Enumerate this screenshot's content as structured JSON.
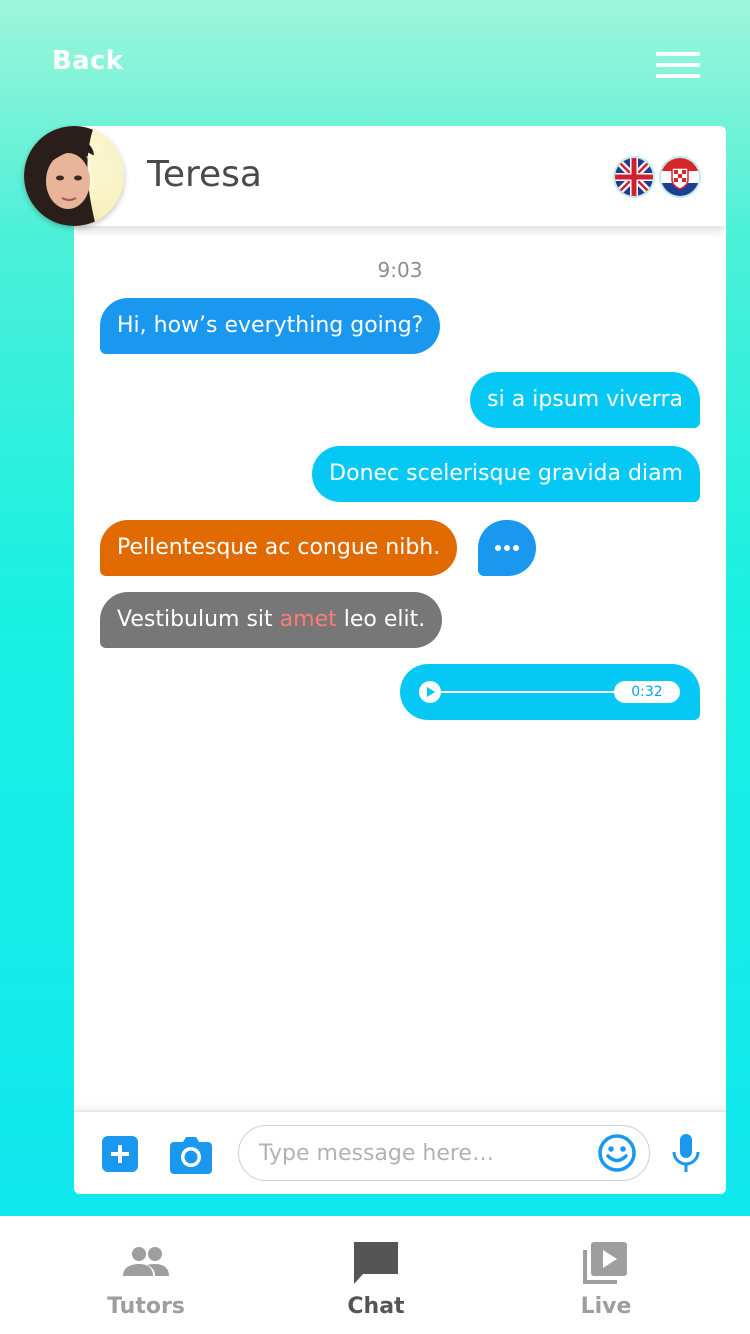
{
  "header": {
    "back_label": "Back",
    "menu_icon": "hamburger-menu-icon"
  },
  "contact": {
    "name": "Teresa",
    "flags": [
      "uk-flag-icon",
      "croatia-flag-icon"
    ]
  },
  "chat": {
    "timestamp": "9:03",
    "messages": [
      {
        "text": "Hi, how’s everything going?",
        "side": "left",
        "color": "#1a98f0"
      },
      {
        "text": "si a ipsum viverra",
        "side": "right",
        "color": "#06c8f5"
      },
      {
        "text": "Donec scelerisque gravida diam",
        "side": "right",
        "color": "#06c8f5"
      },
      {
        "text": "Pellentesque ac congue nibh.",
        "side": "left",
        "color": "#e06a00"
      },
      {
        "text_before": "Vestibulum sit ",
        "highlight": "amet",
        "text_after": " leo elit.",
        "side": "left",
        "color": "#777777",
        "highlight_color": "#ff7b7b"
      }
    ],
    "typing_indicator": true,
    "audio": {
      "duration": "0:32",
      "progress": 0
    }
  },
  "composer": {
    "placeholder": "Type message here…",
    "add_icon": "plus-icon",
    "camera_icon": "camera-icon",
    "emoji_icon": "smiley-icon",
    "mic_icon": "microphone-icon"
  },
  "tabs": [
    {
      "label": "Tutors",
      "icon": "people-icon",
      "active": false
    },
    {
      "label": "Chat",
      "icon": "chat-bubble-icon",
      "active": true
    },
    {
      "label": "Live",
      "icon": "video-library-icon",
      "active": false
    }
  ],
  "colors": {
    "accent": "#1a98f0",
    "outgoing": "#06c8f5",
    "tab_active": "#555555",
    "tab_inactive": "#9e9e9e"
  }
}
